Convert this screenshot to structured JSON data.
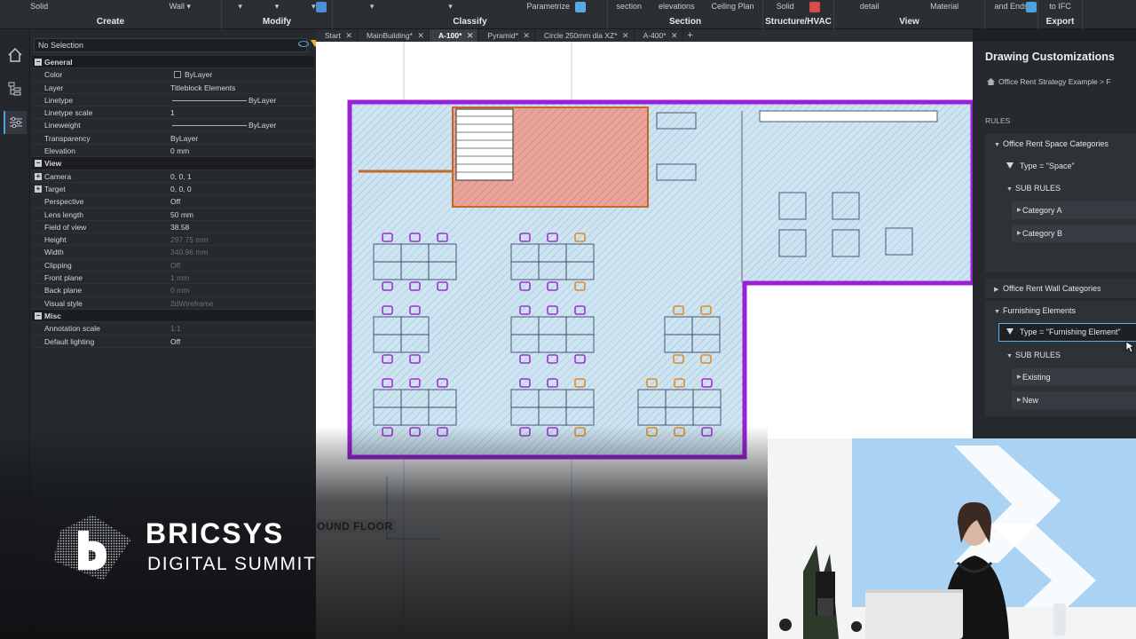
{
  "ribbon": {
    "groups": [
      {
        "label": "Create",
        "cmds": [
          "Solid",
          "",
          "Wall ▾"
        ]
      },
      {
        "label": "Modify",
        "cmds": [
          "▾",
          "▾",
          "▾"
        ]
      },
      {
        "label": "Classify",
        "cmds": [
          "▾",
          "▾",
          "Parametrize"
        ]
      },
      {
        "label": "Section",
        "cmds": [
          "section",
          "elevations",
          "Ceiling Plan"
        ]
      },
      {
        "label": "Structure/HVAC",
        "cmds": [
          "Solid",
          ""
        ]
      },
      {
        "label": "View",
        "cmds": [
          "detail",
          "Material"
        ]
      },
      {
        "label": "",
        "cmds": [
          "and Ends"
        ]
      },
      {
        "label": "Export",
        "cmds": [
          "to IFC"
        ]
      }
    ]
  },
  "properties": {
    "selection": "No Selection",
    "rows": [
      {
        "type": "cat",
        "key": "General",
        "toggle": "−"
      },
      {
        "key": "Color",
        "value": "ByLayer",
        "swatch": true
      },
      {
        "key": "Layer",
        "value": "Titleblock Elements"
      },
      {
        "key": "Linetype",
        "value": "ByLayer",
        "line": true
      },
      {
        "key": "Linetype scale",
        "value": "1"
      },
      {
        "key": "Lineweight",
        "value": "ByLayer",
        "line": true
      },
      {
        "key": "Transparency",
        "value": "ByLayer"
      },
      {
        "key": "Elevation",
        "value": "0 mm"
      },
      {
        "type": "cat",
        "key": "View",
        "toggle": "−"
      },
      {
        "key": "Camera",
        "value": "0, 0, 1",
        "toggle": "+"
      },
      {
        "key": "Target",
        "value": "0, 0, 0",
        "toggle": "+"
      },
      {
        "key": "Perspective",
        "value": "Off"
      },
      {
        "key": "Lens length",
        "value": "50 mm"
      },
      {
        "key": "Field of view",
        "value": "38.58"
      },
      {
        "key": "Height",
        "value": "297.75 mm",
        "dim": true
      },
      {
        "key": "Width",
        "value": "340.96 mm",
        "dim": true
      },
      {
        "key": "Clipping",
        "value": "Off",
        "dim": true
      },
      {
        "key": "Front plane",
        "value": "1 mm",
        "dim": true
      },
      {
        "key": "Back plane",
        "value": "0 mm",
        "dim": true
      },
      {
        "key": "Visual style",
        "value": "2dWireframe",
        "dim": true
      },
      {
        "type": "cat",
        "key": "Misc",
        "toggle": "−"
      },
      {
        "key": "Annotation scale",
        "value": "1:1",
        "dim": true
      },
      {
        "key": "Default lighting",
        "value": "Off"
      }
    ]
  },
  "tabs": [
    {
      "label": "Start",
      "active": false
    },
    {
      "label": "MainBuilding*",
      "active": false
    },
    {
      "label": "A-100*",
      "active": true
    },
    {
      "label": "Pyramid*",
      "active": false
    },
    {
      "label": "Circle 250mm dia XZ*",
      "active": false
    },
    {
      "label": "A-400*",
      "active": false
    }
  ],
  "canvas": {
    "floor_label": "OUND FLOOR",
    "colors": {
      "wall": "#9b1fd6",
      "floor_hatch": "#cfe4f1",
      "core": "#e9a59b",
      "chair_purple": "#a12fd2",
      "chair_orange": "#e28a24"
    }
  },
  "drawing_customizations": {
    "title": "Drawing Customizations",
    "breadcrumb": "Office Rent Strategy Example > F",
    "rules_header": "RULES",
    "items": {
      "space_categories": "Office Rent Space Categories",
      "type_space": "Type = \"Space\"",
      "sub_rules_1": "SUB RULES",
      "category_a": "Category A",
      "category_b": "Category B",
      "wall_categories": "Office Rent Wall Categories",
      "furnishing": "Furnishing Elements",
      "type_furnishing": "Type = \"Furnishing Element\"",
      "sub_rules_2": "SUB RULES",
      "existing": "Existing",
      "new": "New"
    }
  },
  "branding": {
    "name": "BRICSYS",
    "subtitle": "DIGITAL SUMMIT"
  }
}
